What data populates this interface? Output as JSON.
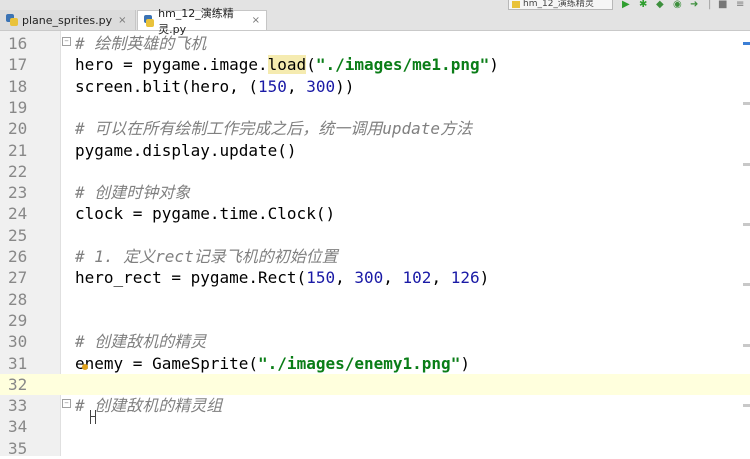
{
  "tabs": [
    {
      "label": "plane_sprites.py",
      "close": "×"
    },
    {
      "label": "hm_12_演练精灵.py",
      "close": "×"
    }
  ],
  "toolbar": {
    "run_config": "hm_12_演练精灵"
  },
  "lines": [
    {
      "num": "16",
      "tokens": [
        {
          "t": "# 绘制英雄的飞机",
          "c": "comment"
        }
      ]
    },
    {
      "num": "17",
      "tokens": [
        {
          "t": "hero = pygame.image.",
          "c": ""
        },
        {
          "t": "load",
          "c": "hl"
        },
        {
          "t": "(",
          "c": ""
        },
        {
          "t": "\"./images/me1.png\"",
          "c": "string"
        },
        {
          "t": ")",
          "c": ""
        }
      ]
    },
    {
      "num": "18",
      "tokens": [
        {
          "t": "screen.blit(hero, (",
          "c": ""
        },
        {
          "t": "150",
          "c": "num"
        },
        {
          "t": ", ",
          "c": ""
        },
        {
          "t": "300",
          "c": "num"
        },
        {
          "t": "))",
          "c": ""
        }
      ]
    },
    {
      "num": "19",
      "tokens": []
    },
    {
      "num": "20",
      "tokens": [
        {
          "t": "# 可以在所有绘制工作完成之后，统一调用update方法",
          "c": "comment"
        }
      ]
    },
    {
      "num": "21",
      "tokens": [
        {
          "t": "pygame.display.update()",
          "c": ""
        }
      ]
    },
    {
      "num": "22",
      "tokens": []
    },
    {
      "num": "23",
      "tokens": [
        {
          "t": "# 创建时钟对象",
          "c": "comment"
        }
      ]
    },
    {
      "num": "24",
      "tokens": [
        {
          "t": "clock = pygame.time.Clock()",
          "c": ""
        }
      ]
    },
    {
      "num": "25",
      "tokens": []
    },
    {
      "num": "26",
      "tokens": [
        {
          "t": "# 1. 定义rect记录飞机的初始位置",
          "c": "comment"
        }
      ]
    },
    {
      "num": "27",
      "tokens": [
        {
          "t": "hero_rect = pygame.Rect(",
          "c": ""
        },
        {
          "t": "150",
          "c": "num"
        },
        {
          "t": ", ",
          "c": ""
        },
        {
          "t": "300",
          "c": "num"
        },
        {
          "t": ", ",
          "c": ""
        },
        {
          "t": "102",
          "c": "num"
        },
        {
          "t": ", ",
          "c": ""
        },
        {
          "t": "126",
          "c": "num"
        },
        {
          "t": ")",
          "c": ""
        }
      ]
    },
    {
      "num": "28",
      "tokens": []
    },
    {
      "num": "29",
      "tokens": []
    },
    {
      "num": "30",
      "tokens": [
        {
          "t": "# 创建敌机的精灵",
          "c": "comment"
        }
      ]
    },
    {
      "num": "31",
      "tokens": [
        {
          "t": "enemy = GameSprite(",
          "c": ""
        },
        {
          "t": "\"./images/enemy1.png\"",
          "c": "string"
        },
        {
          "t": ")",
          "c": ""
        }
      ]
    },
    {
      "num": "32",
      "tokens": []
    },
    {
      "num": "33",
      "tokens": [
        {
          "t": "# 创建敌机的精灵组",
          "c": "comment"
        }
      ]
    },
    {
      "num": "34",
      "tokens": []
    },
    {
      "num": "35",
      "tokens": []
    }
  ],
  "current_line": "32",
  "colors": {
    "comment": "#808080",
    "string": "#0a7d17",
    "number": "#1a1aa6",
    "current_line": "#ffffdd",
    "gutter": "#f0f0f0"
  }
}
